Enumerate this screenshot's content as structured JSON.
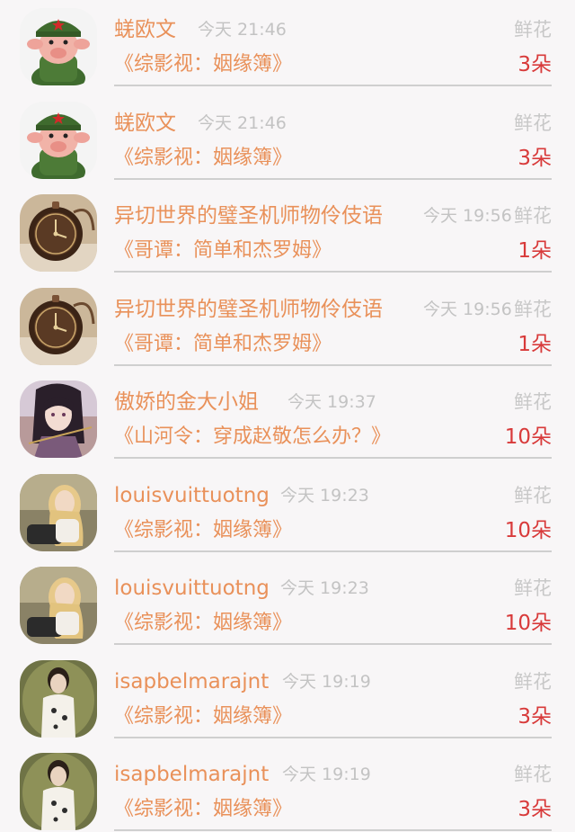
{
  "items": [
    {
      "name": "蜣欧文",
      "time": "今天 21:46",
      "gift": "鲜花",
      "book": "《综影视：姻缘簿》",
      "count": "3朵",
      "avatar": "pig-soldier"
    },
    {
      "name": "蜣欧文",
      "time": "今天 21:46",
      "gift": "鲜花",
      "book": "《综影视：姻缘簿》",
      "count": "3朵",
      "avatar": "pig-soldier"
    },
    {
      "name": "异切世界的璧圣机师物伶伎语",
      "time": "今天 19:56",
      "gift": "鲜花",
      "book": "《哥谭：简单和杰罗姆》",
      "count": "1朵",
      "avatar": "pocket-watch"
    },
    {
      "name": "异切世界的璧圣机师物伶伎语",
      "time": "今天 19:56",
      "gift": "鲜花",
      "book": "《哥谭：简单和杰罗姆》",
      "count": "1朵",
      "avatar": "pocket-watch"
    },
    {
      "name": "傲娇的金大小姐",
      "time": "今天 19:37",
      "gift": "鲜花",
      "book": "《山河令：穿成赵敬怎么办？》",
      "count": "10朵",
      "avatar": "anime-girl"
    },
    {
      "name": "louisvuittuotng",
      "time": "今天 19:23",
      "gift": "鲜花",
      "book": "《综影视：姻缘簿》",
      "count": "10朵",
      "avatar": "blonde-woman"
    },
    {
      "name": "louisvuittuotng",
      "time": "今天 19:23",
      "gift": "鲜花",
      "book": "《综影视：姻缘簿》",
      "count": "10朵",
      "avatar": "blonde-woman"
    },
    {
      "name": "isapbelmarajnt",
      "time": "今天 19:19",
      "gift": "鲜花",
      "book": "《综影视：姻缘簿》",
      "count": "3朵",
      "avatar": "qipao-woman"
    },
    {
      "name": "isapbelmarajnt",
      "time": "今天 19:19",
      "gift": "鲜花",
      "book": "《综影视：姻缘簿》",
      "count": "3朵",
      "avatar": "qipao-woman"
    }
  ],
  "colors": {
    "name": "#e9915a",
    "book": "#e9915a",
    "count": "#d83a3a",
    "time": "#c3c3c3",
    "gift": "#c8c8c8",
    "background": "#f8f6f7",
    "divider": "#cfcfcf"
  }
}
